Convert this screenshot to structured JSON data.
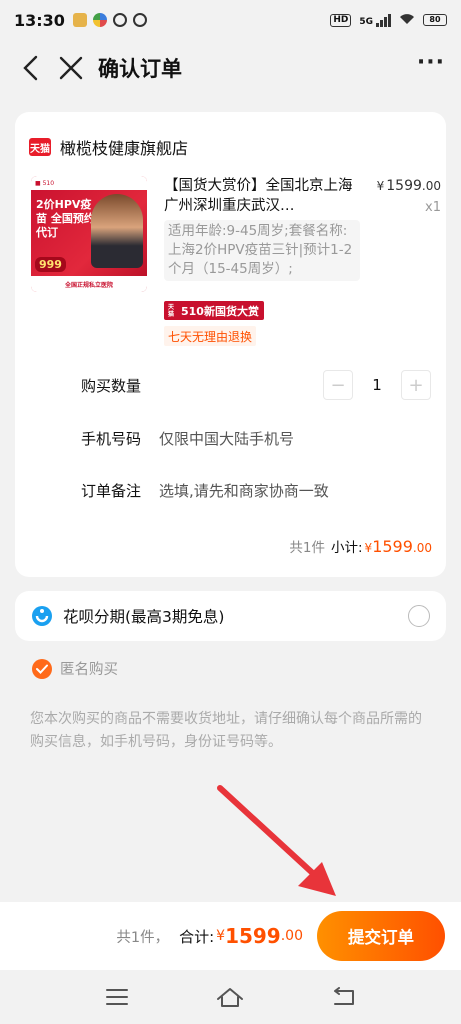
{
  "status": {
    "time": "13:30",
    "hd": "HD",
    "signal": "5G",
    "battery": "80"
  },
  "nav": {
    "title": "确认订单",
    "more": "···"
  },
  "shop": {
    "logo_text": "天猫",
    "name": "橄榄枝健康旗舰店"
  },
  "product": {
    "title": "【国货大赏价】全国北京上海广州深圳重庆武汉…",
    "price_yen": "¥",
    "price_int": "1599",
    "price_dec": ".00",
    "qty": "x1",
    "sku": "适用年龄:9-45周岁;套餐名称:上海2价HPV疫苗三针|预计1-2个月（15-45周岁）;",
    "promo_small": "天猫",
    "promo_text": "510新国货大赏",
    "return_tag": "七天无理由退换",
    "image": {
      "top_text": "2价HPV疫苗 全国预约代订",
      "title": "2价HPV疫苗 全国预约代订",
      "price": "999",
      "strip": "全国正规私立医院"
    }
  },
  "fields": {
    "qty_label": "购买数量",
    "qty_minus": "−",
    "qty_value": "1",
    "qty_plus": "+",
    "phone_label": "手机号码",
    "phone_value": "仅限中国大陆手机号",
    "note_label": "订单备注",
    "note_value": "选填,请先和商家协商一致"
  },
  "subtotal": {
    "count": "共1件",
    "label": "小计:",
    "yen": "¥",
    "int": "1599",
    "dec": ".00"
  },
  "huabei": {
    "label": "花呗分期(最高3期免息)"
  },
  "anonymous": {
    "label": "匿名购买"
  },
  "notice": "您本次购买的商品不需要收货地址，请仔细确认每个商品所需的购买信息，如手机号码，身份证号码等。",
  "bottom": {
    "count": "共1件，",
    "label": "合计:",
    "yen": "¥",
    "int": "1599",
    "dec": ".00",
    "submit": "提交订单"
  },
  "colors": {
    "accent": "#ff5000",
    "tmall_red": "#e81d2a",
    "annotation_arrow": "#e8343a"
  }
}
